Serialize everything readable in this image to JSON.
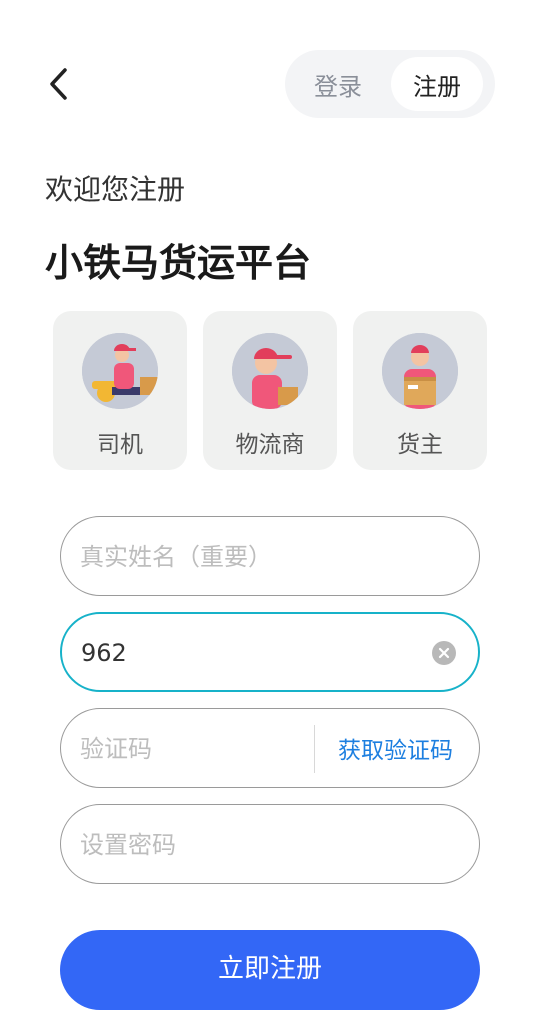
{
  "header": {
    "back_icon": "chevron-left-icon",
    "tabs": [
      {
        "label": "登录",
        "active": false
      },
      {
        "label": "注册",
        "active": true
      }
    ]
  },
  "intro": {
    "welcome": "欢迎您注册",
    "brand": "小铁马货运平台"
  },
  "roles": [
    {
      "label": "司机",
      "icon": "driver-avatar-icon"
    },
    {
      "label": "物流商",
      "icon": "logistics-avatar-icon"
    },
    {
      "label": "货主",
      "icon": "shipper-avatar-icon"
    }
  ],
  "form": {
    "name": {
      "placeholder": "真实姓名（重要）",
      "value": ""
    },
    "phone": {
      "placeholder": "",
      "value": "962",
      "focused": true
    },
    "code": {
      "placeholder": "验证码",
      "value": "",
      "action": "获取验证码"
    },
    "password": {
      "placeholder": "设置密码",
      "value": ""
    },
    "submit": "立即注册"
  },
  "colors": {
    "primary": "#3367f6",
    "focus_border": "#17b2c9",
    "link": "#1d7fe0"
  }
}
